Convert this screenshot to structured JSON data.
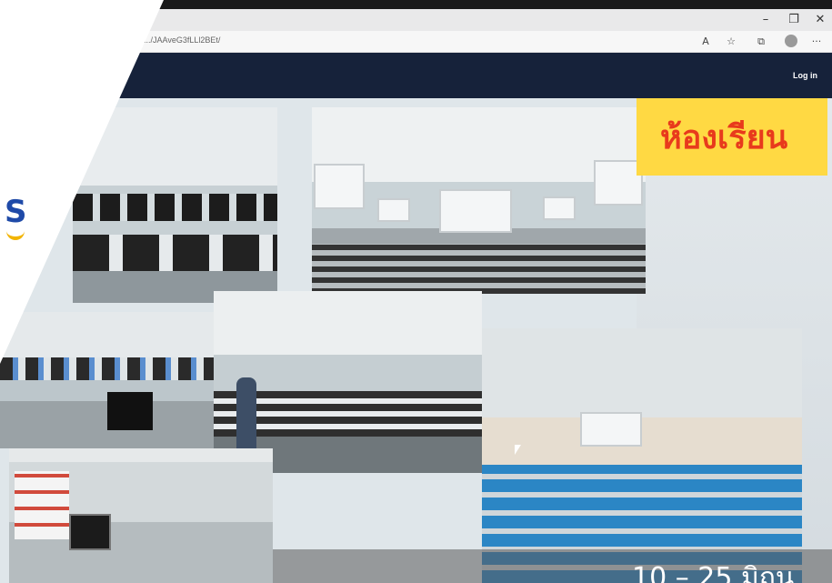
{
  "browser": {
    "url": ".../JAAveG3fLLl2BEt/",
    "window_controls": {
      "minimize": "–",
      "restore": "❐",
      "close": "✕"
    },
    "toolbar_icons": [
      "read-aloud-icon",
      "favorites-icon",
      "collections-icon",
      "profile-icon",
      "more-icon"
    ]
  },
  "site": {
    "login_label": "Log in"
  },
  "slide": {
    "title": "ห้องเรียน",
    "caption": "10 – 25 มิถุน",
    "photos": [
      "computer-lab-photo",
      "lecture-hall-photo",
      "computer-lab-2-photo",
      "classroom-lecture-photo",
      "auditorium-blue-seats-photo",
      "library-corner-photo"
    ]
  },
  "colors": {
    "navbar": "#16223a",
    "title_box": "#ffd943",
    "title_text": "#e83a1c",
    "seat_blue": "#2b86c5",
    "logo_blue": "#1f4aa8",
    "logo_gold": "#f2b400"
  }
}
